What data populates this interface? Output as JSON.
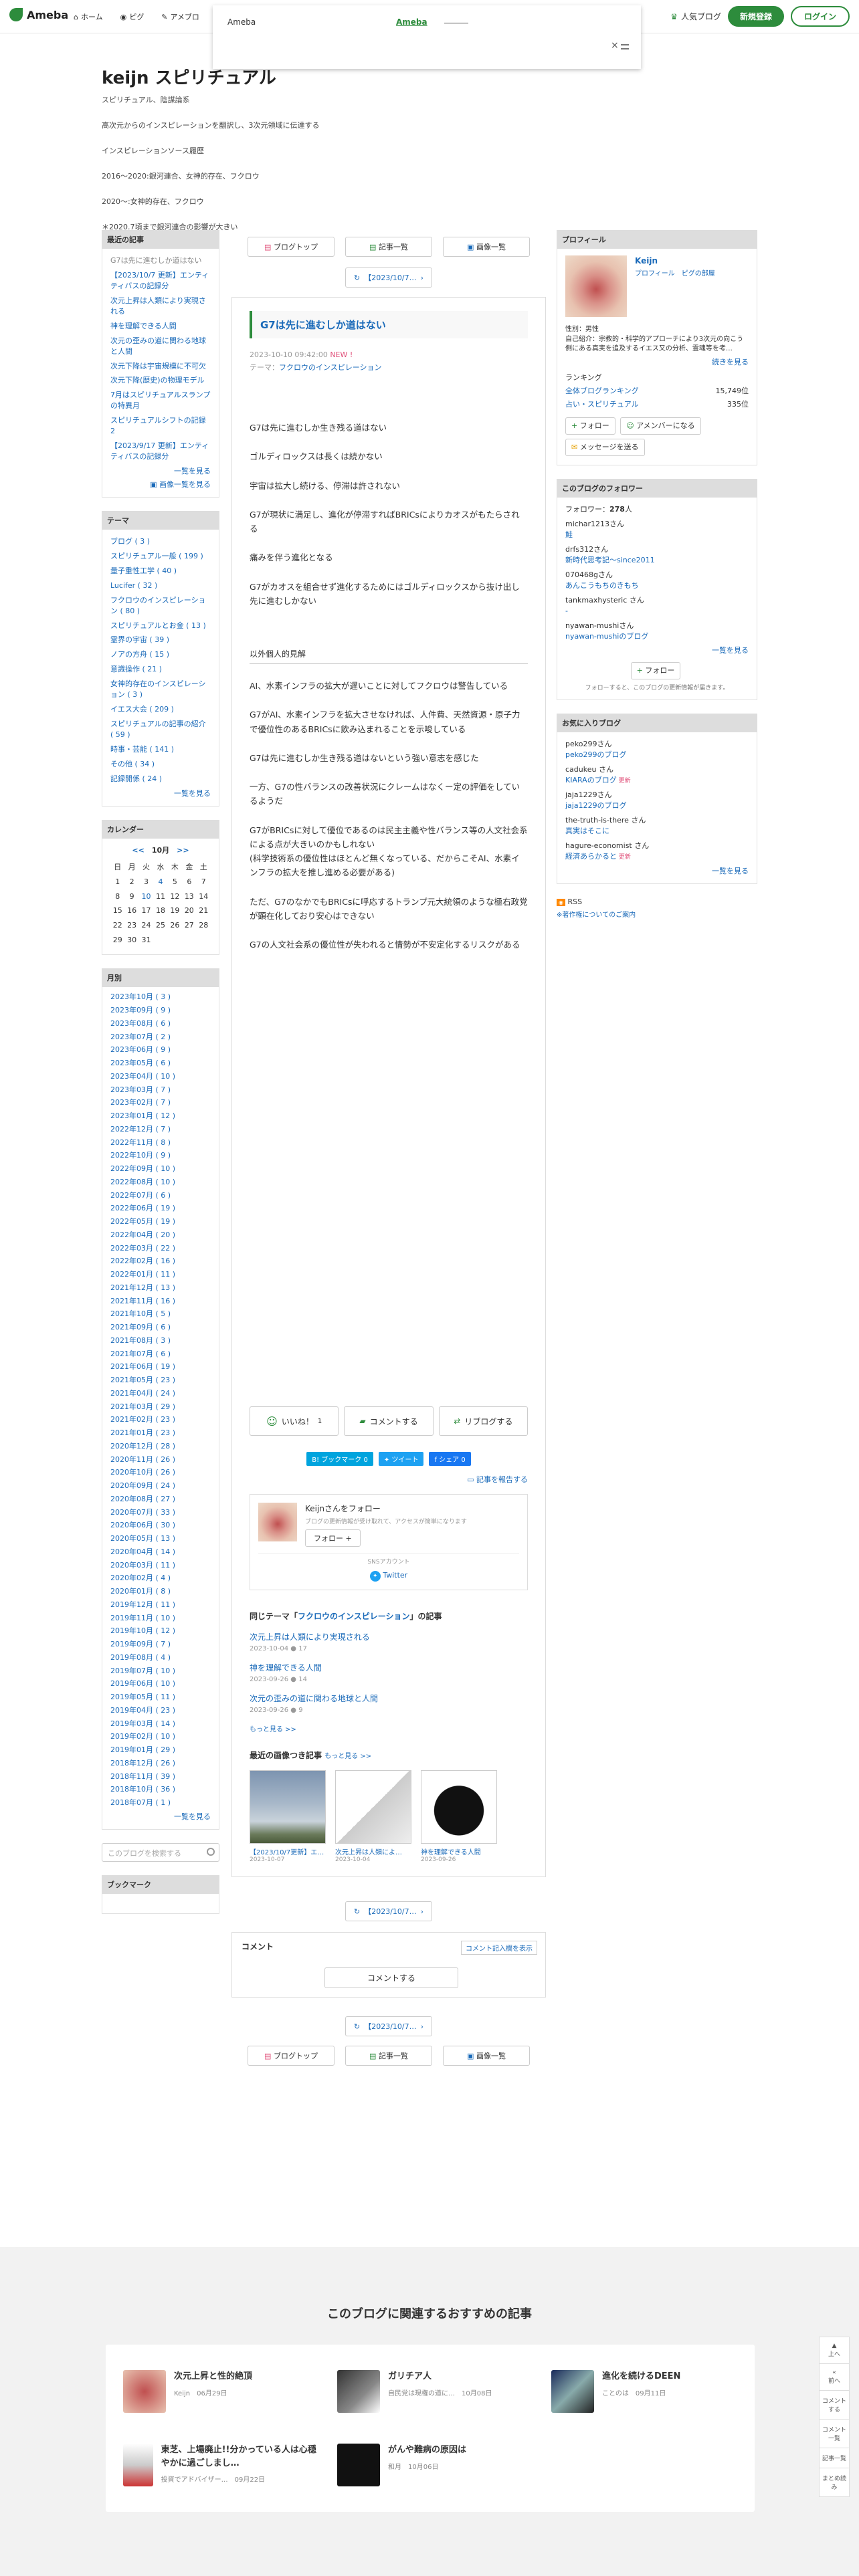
{
  "topbar": {
    "logo": "Ameba",
    "nav": [
      "ホーム",
      "ピグ",
      "アメブロ"
    ],
    "popular": "人気ブログ",
    "signup": "新規登録",
    "login": "ログイン"
  },
  "ad": {
    "title": "Ameba",
    "mark": "Ameba",
    "close": "×"
  },
  "blog": {
    "title": "keijn スピリチュアル",
    "subtitle": "スピリチュアル、陰謀論系",
    "desc": [
      "高次元からのインスピレーションを翻訳し、3次元領域に伝達する",
      "インスピレーションソース履歴",
      "2016〜2020:銀河連合、女神的存在、フクロウ",
      "2020〜:女神的存在、フクロウ",
      "＊2020.7頃まで銀河連合の影響が大きい"
    ]
  },
  "tabs": {
    "top": "ブログトップ",
    "list": "記事一覧",
    "images": "画像一覧",
    "prev": "【2023/10/7…"
  },
  "article": {
    "title": "G7は先に進むしか道はない",
    "date": "2023-10-10 09:42:00",
    "new": "NEW !",
    "theme_label": "テーマ：",
    "theme": "フクロウのインスピレーション",
    "p1": [
      "G7は先に進むしか生き残る道はない",
      "ゴルディロックスは長くは続かない",
      "宇宙は拡大し続ける、停滞は許されない",
      "G7が現状に満足し、進化が停滞すればBRICsによりカオスがもたらされる",
      "痛みを伴う進化となる",
      "G7がカオスを組合せず進化するためにはゴルディロックスから抜け出し先に進むしかない"
    ],
    "section": "以外個人的見解",
    "p2": [
      "AI、水素インフラの拡大が遅いことに対してフクロウは警告している",
      "G7がAI、水素インフラを拡大させなければ、人件費、天然資源・原子力で優位性のあるBRICsに飲み込まれることを示唆している",
      "G7は先に進むしか生き残る道はないという強い意志を感じた",
      "一方、G7の性バランスの改善状況にクレームはなくー定の評価をしているようだ",
      "G7がBRICsに対して優位であるのは民主主義や性バランス等の人文社会系による点が大きいのかもしれない\n(科学技術系の優位性はほとんど無くなっている、だからこそAI、水素インフラの拡大を推し進める必要がある)",
      "ただ、G7のなかでもBRICsに呼応するトランプ元大統領のような極右政党が顕在化しており安心はできない",
      "G7の人文社会系の優位性が失われると情勢が不安定化するリスクがある"
    ]
  },
  "actions": {
    "like": "いいね！",
    "like_count": "1",
    "comment": "コメントする",
    "reblog": "リブログする"
  },
  "share": {
    "hatena": "B! ブックマーク",
    "hatena_count": "0",
    "tweet": "ツイート",
    "fb": "シェア",
    "fb_count": "0",
    "report": "記事を報告する"
  },
  "follow": {
    "name": "Keijnさんをフォロー",
    "desc": "ブログの更新情報が受け取れて、アクセスが簡単になります",
    "button": "フォロー",
    "sns": "SNSアカウント",
    "twitter": "Twitter"
  },
  "related": {
    "heading_pre": "同じテーマ「",
    "heading_theme": "フクロウのインスピレーション",
    "heading_post": "」の記事",
    "items": [
      {
        "t": "次元上昇は人類により実現される",
        "d": "2023-10-04",
        "c": "17"
      },
      {
        "t": "神を理解できる人間",
        "d": "2023-09-26",
        "c": "14"
      },
      {
        "t": "次元の歪みの道に関わる地球と人間",
        "d": "2023-09-26",
        "c": "9"
      }
    ],
    "more": "もっと見る >>",
    "img_heading": "最近の画像つき記事",
    "img_more": "もっと見る >>",
    "thumbs": [
      {
        "cap": "【2023/10/7更新】エ…",
        "d": "2023-10-07"
      },
      {
        "cap": "次元上昇は人類によ…",
        "d": "2023-10-04"
      },
      {
        "cap": "神を理解できる人間",
        "d": "2023-09-26"
      }
    ]
  },
  "comment": {
    "head": "コメント",
    "rules": "コメント記入欄を表示",
    "button": "コメントする"
  },
  "left": {
    "recent": {
      "head": "最近の記事",
      "items": [
        "G7は先に進むしか道はない",
        "【2023/10/7 更新】エンティティバスの記録分",
        "次元上昇は人類により実現される",
        "神を理解できる人間",
        "次元の歪みの道に関わる地球と人間",
        "次元下降は宇宙規模に不可欠",
        "次元下降(歴史)の物理モデル",
        "7月はスピリチュアルスランプの特異月",
        "スピリチュアルシフトの記録 2",
        "【2023/9/17 更新】エンティティバスの記録分"
      ],
      "more": "一覧を見る",
      "imgmore": "画像一覧を見る"
    },
    "theme": {
      "head": "テーマ",
      "items": [
        "ブログ ( 3 )",
        "スピリチュアル一般 ( 199 )",
        "量子重性工学 ( 40 )",
        "Lucifer ( 32 )",
        "フクロウのインスピレーション ( 80 )",
        "スピリチュアルとお金 ( 13 )",
        "霊界の宇宙 ( 39 )",
        "ノアの方舟 ( 15 )",
        "意識操作 ( 21 )",
        "女神的存在のインスピレーション ( 3 )",
        "イエス大会 ( 209 )",
        "スピリチュアルの記事の紹介 ( 59 )",
        "時事・芸能 ( 141 )",
        "その他 ( 34 )",
        "記録開係 ( 24 )"
      ],
      "more": "一覧を見る"
    },
    "calendar": {
      "head": "カレンダー",
      "prev": "<<",
      "month": "10月",
      "next": ">>",
      "dow": [
        "日",
        "月",
        "火",
        "水",
        "木",
        "金",
        "土"
      ],
      "weeks": [
        [
          "1",
          "2",
          "3",
          "4",
          "5",
          "6",
          "7"
        ],
        [
          "8",
          "9",
          "10",
          "11",
          "12",
          "13",
          "14"
        ],
        [
          "15",
          "16",
          "17",
          "18",
          "19",
          "20",
          "21"
        ],
        [
          "22",
          "23",
          "24",
          "25",
          "26",
          "27",
          "28"
        ],
        [
          "29",
          "30",
          "31",
          "",
          "",
          "",
          ""
        ]
      ]
    },
    "monthly": {
      "head": "月別",
      "items": [
        "2023年10月 ( 3 )",
        "2023年09月 ( 9 )",
        "2023年08月 ( 6 )",
        "2023年07月 ( 2 )",
        "2023年06月 ( 9 )",
        "2023年05月 ( 6 )",
        "2023年04月 ( 10 )",
        "2023年03月 ( 7 )",
        "2023年02月 ( 7 )",
        "2023年01月 ( 12 )",
        "2022年12月 ( 7 )",
        "2022年11月 ( 8 )",
        "2022年10月 ( 9 )",
        "2022年09月 ( 10 )",
        "2022年08月 ( 10 )",
        "2022年07月 ( 6 )",
        "2022年06月 ( 19 )",
        "2022年05月 ( 19 )",
        "2022年04月 ( 20 )",
        "2022年03月 ( 22 )",
        "2022年02月 ( 16 )",
        "2022年01月 ( 11 )",
        "2021年12月 ( 13 )",
        "2021年11月 ( 16 )",
        "2021年10月 ( 5 )",
        "2021年09月 ( 6 )",
        "2021年08月 ( 3 )",
        "2021年07月 ( 6 )",
        "2021年06月 ( 19 )",
        "2021年05月 ( 23 )",
        "2021年04月 ( 24 )",
        "2021年03月 ( 29 )",
        "2021年02月 ( 23 )",
        "2021年01月 ( 23 )",
        "2020年12月 ( 28 )",
        "2020年11月 ( 26 )",
        "2020年10月 ( 26 )",
        "2020年09月 ( 24 )",
        "2020年08月 ( 27 )",
        "2020年07月 ( 33 )",
        "2020年06月 ( 30 )",
        "2020年05月 ( 13 )",
        "2020年04月 ( 14 )",
        "2020年03月 ( 11 )",
        "2020年02月 ( 4 )",
        "2020年01月 ( 8 )",
        "2019年12月 ( 11 )",
        "2019年11月 ( 10 )",
        "2019年10月 ( 12 )",
        "2019年09月 ( 7 )",
        "2019年08月 ( 4 )",
        "2019年07月 ( 10 )",
        "2019年06月 ( 10 )",
        "2019年05月 ( 11 )",
        "2019年04月 ( 23 )",
        "2019年03月 ( 14 )",
        "2019年02月 ( 10 )",
        "2019年01月 ( 29 )",
        "2018年12月 ( 26 )",
        "2018年11月 ( 39 )",
        "2018年10月 ( 36 )",
        "2018年07月 ( 1 )"
      ],
      "more": "一覧を見る"
    },
    "search": {
      "placeholder": "このブログを検索する"
    },
    "bookmark": {
      "head": "ブックマーク"
    }
  },
  "right": {
    "profile": {
      "head": "プロフィール",
      "name": "Keijn",
      "links": "プロフィール　ピグの部屋",
      "body": "性別：男性\n自己紹介：宗教的・科学的アプローチにより3次元の向こう側にある真実を追及するイエス又の分析、霊魂等を考…",
      "more": "続きを見る",
      "rank_head": "ランキング",
      "ranks": [
        {
          "l": "全体ブログランキング",
          "v": "15,749位"
        },
        {
          "l": "占い・スピリチュアル",
          "v": "335位"
        }
      ],
      "btns": [
        "フォロー",
        "アメンバーになる",
        "メッセージを送る"
      ]
    },
    "followers": {
      "head": "このブログのフォロワー",
      "count_label": "フォロワー：",
      "count": "278",
      "count_unit": "人",
      "items": [
        {
          "n": "michar1213さん",
          "b": "鮭"
        },
        {
          "n": "drfs312さん",
          "b": "新時代思考記〜since2011"
        },
        {
          "n": "070468gさん",
          "b": "あんこうもちのきもち"
        },
        {
          "n": "tankmaxhysteric さん",
          "b": "-"
        },
        {
          "n": "nyawan-mushiさん",
          "b": "nyawan-mushiのブログ"
        }
      ],
      "more": "一覧を見る",
      "button": "フォロー",
      "note": "フォローすると、このブログの更新情報が届きます。"
    },
    "favs": {
      "head": "お気に入りブログ",
      "items": [
        {
          "n": "peko299さん",
          "b": "peko299のブログ"
        },
        {
          "n": "cadukeu さん",
          "b": "KIARAのブログ"
        },
        {
          "n": "jaja1229さん",
          "b": "jaja1229のブログ"
        },
        {
          "n": "the-truth-is-there さん",
          "b": "真実はそこに"
        },
        {
          "n": "hagure-economist さん",
          "b": "経済あらかると"
        }
      ],
      "more": "一覧を見る",
      "upd": "更新"
    },
    "rss": "RSS",
    "rss2": "※著作権についてのご案内"
  },
  "footer": {
    "title": "このブログに関連するおすすめの記事",
    "recs": [
      {
        "t": "次元上昇と性的絶頂",
        "s": "Keijn　06月29日"
      },
      {
        "t": "ガリチア人",
        "s": "自民党は現権の道に…　10月08日"
      },
      {
        "t": "進化を続けるDEEN",
        "s": "ことのは　09月11日"
      },
      {
        "t": "東芝、上場廃止!!分かっている人は心穏やかに過ごしまし…",
        "s": "投資でアドバイザー…　09月22日"
      },
      {
        "t": "がんや難病の原因は",
        "s": "和月　10月06日"
      }
    ],
    "tools": [
      "上へ",
      "前へ",
      "コメントする",
      "コメント一覧",
      "記事一覧",
      "まとめ読み"
    ]
  },
  "colors": {
    "accent": "#2d8c3c",
    "link": "#1a6ab9",
    "new": "#e0507a"
  }
}
